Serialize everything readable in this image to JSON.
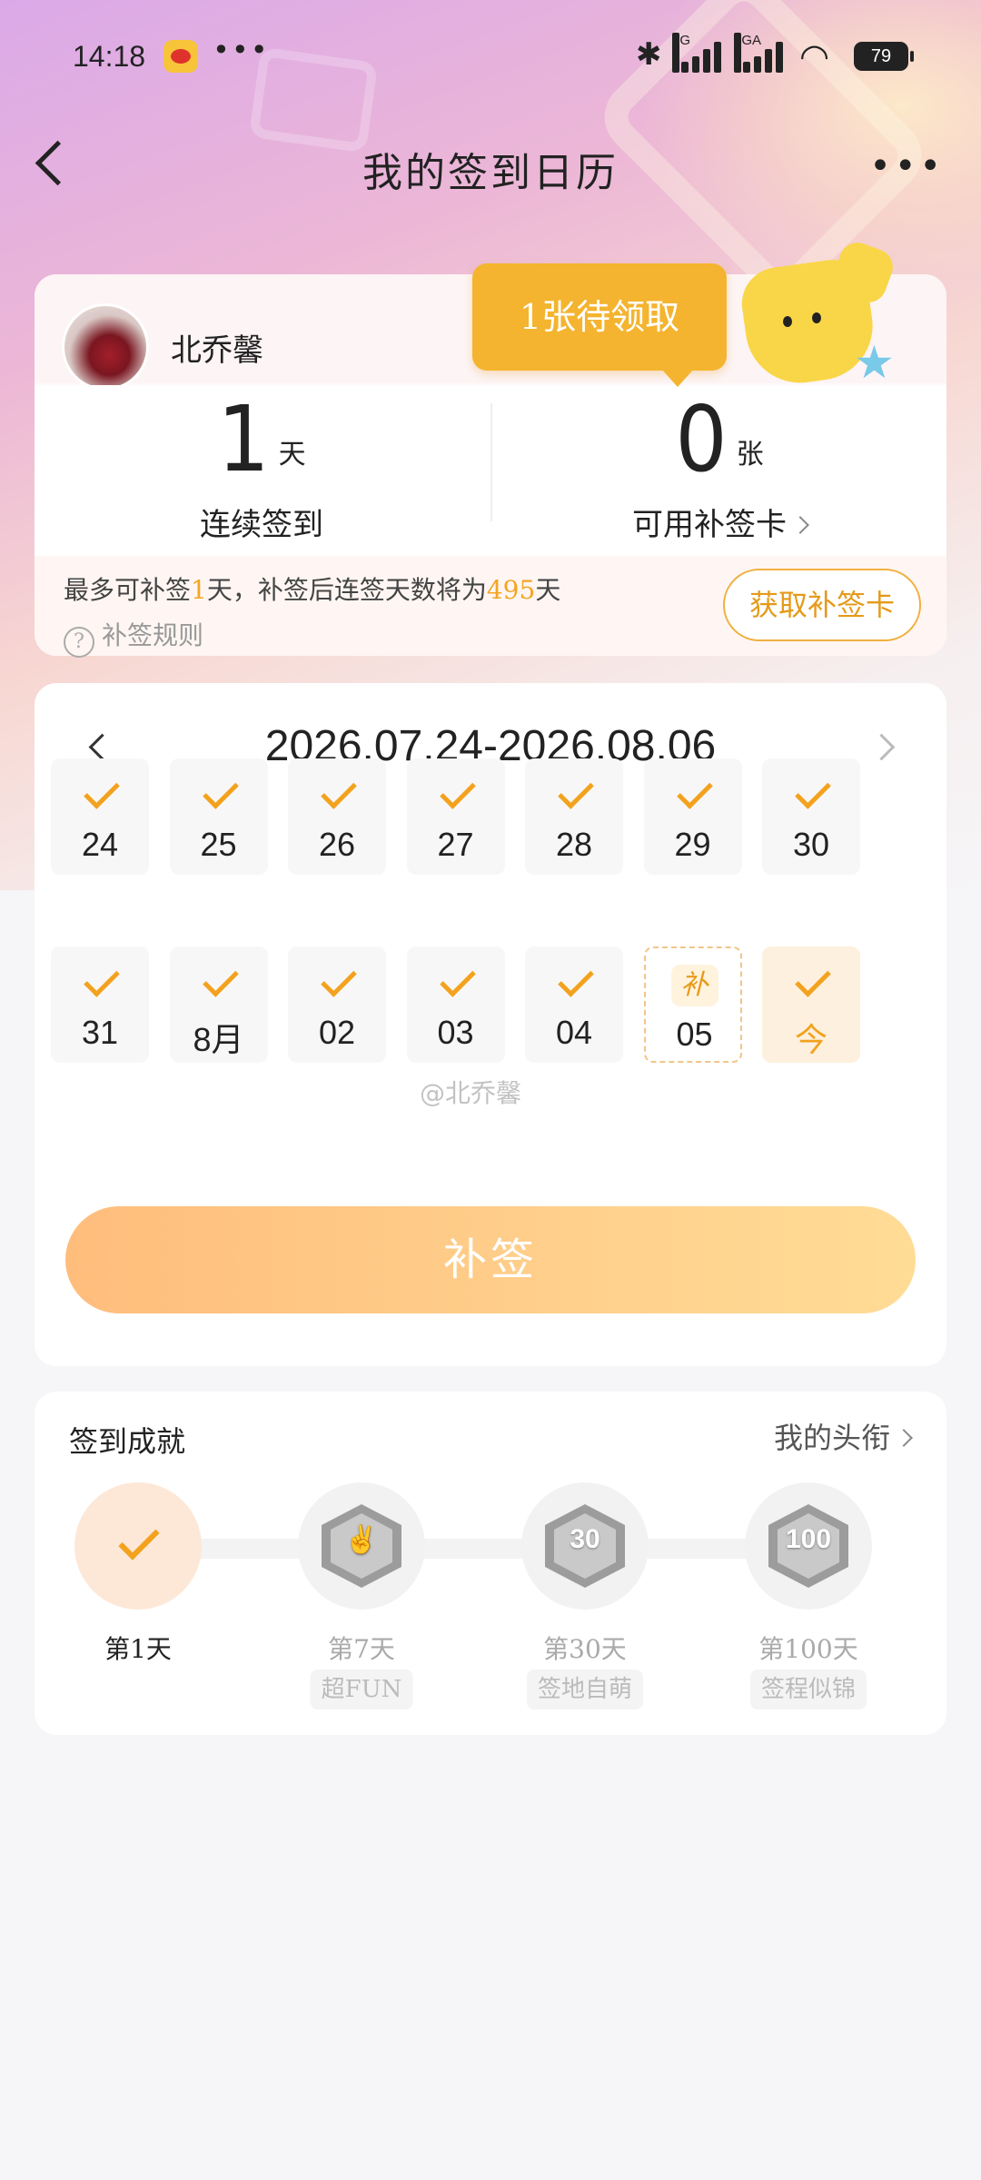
{
  "status_bar": {
    "time": "14:18",
    "more": "•••",
    "signal1_label": "5G",
    "signal2_label": "5GA",
    "battery": "79"
  },
  "nav": {
    "title": "我的签到日历",
    "more": "•••"
  },
  "profile": {
    "username": "北乔馨"
  },
  "tooltip": {
    "text": "1张待领取"
  },
  "stats": {
    "streak": {
      "value": "1",
      "unit": "天",
      "label": "连续签到"
    },
    "cards": {
      "value": "0",
      "unit": "张",
      "label": "可用补签卡"
    }
  },
  "rule": {
    "text_prefix": "最多可补签",
    "max_days": "1",
    "text_mid": "天，补签后连签天数将为",
    "result_days": "495",
    "text_suffix": "天",
    "link": "补签规则",
    "get_card_button": "获取补签卡"
  },
  "calendar": {
    "range": "2026.07.24-2026.08.06",
    "days": [
      {
        "label": "24",
        "state": "checked"
      },
      {
        "label": "25",
        "state": "checked"
      },
      {
        "label": "26",
        "state": "checked"
      },
      {
        "label": "27",
        "state": "checked"
      },
      {
        "label": "28",
        "state": "checked"
      },
      {
        "label": "29",
        "state": "checked"
      },
      {
        "label": "30",
        "state": "checked"
      },
      {
        "label": "31",
        "state": "checked"
      },
      {
        "label": "8月",
        "state": "checked"
      },
      {
        "label": "02",
        "state": "checked"
      },
      {
        "label": "03",
        "state": "checked"
      },
      {
        "label": "04",
        "state": "checked"
      },
      {
        "label": "05",
        "state": "makeup",
        "badge": "补"
      },
      {
        "label": "今",
        "state": "today"
      }
    ],
    "makeup_button": "补签"
  },
  "watermark": "@北乔馨",
  "achievements": {
    "title": "签到成就",
    "link": "我的头衔",
    "items": [
      {
        "day": "第1天",
        "tag": "",
        "state": "done",
        "medal": ""
      },
      {
        "day": "第7天",
        "tag": "超FUN",
        "state": "locked",
        "medal": "✌"
      },
      {
        "day": "第30天",
        "tag": "签地自萌",
        "state": "locked",
        "medal": "30"
      },
      {
        "day": "第100天",
        "tag": "签程似锦",
        "state": "locked",
        "medal": "100"
      }
    ]
  },
  "colors": {
    "accent": "#f3a21e",
    "tooltip": "#f4b42f",
    "button_start": "#ffbd7c",
    "button_end": "#ffdc96"
  }
}
